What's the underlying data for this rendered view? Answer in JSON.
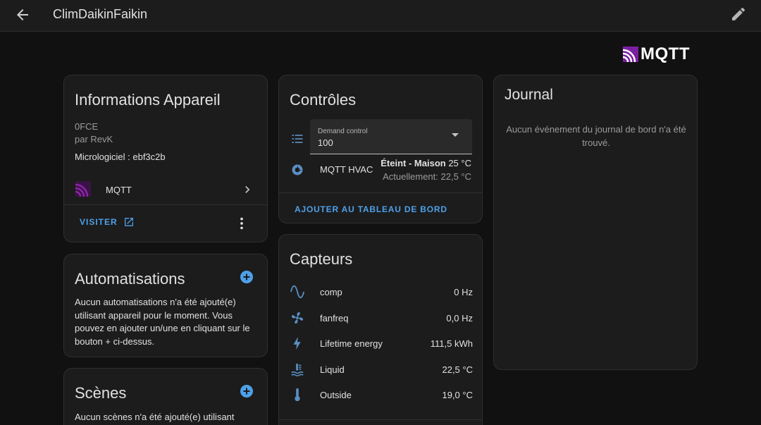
{
  "header": {
    "title": "ClimDaikinFaikin",
    "back_icon": "arrow-left-icon",
    "edit_icon": "pencil-icon"
  },
  "brand": {
    "logo_text": "MQTT",
    "accent_color": "#7b1fa2"
  },
  "device_info": {
    "title": "Informations Appareil",
    "model": "0FCE",
    "manufacturer": "par RevK",
    "firmware": "Micrologiciel : ebf3c2b",
    "integration": "MQTT",
    "visit_label": "VISITER"
  },
  "automations": {
    "title": "Automatisations",
    "empty_text": "Aucun automatisations n'a été ajouté(e) utilisant appareil pour le moment. Vous pouvez en ajouter un/une en cliquant sur le bouton + ci-dessus."
  },
  "scenes": {
    "title": "Scènes",
    "empty_text": "Aucun scènes n'a été ajouté(e) utilisant"
  },
  "controls": {
    "title": "Contrôles",
    "select": {
      "label": "Demand control",
      "value": "100"
    },
    "hvac": {
      "name": "MQTT HVAC",
      "state_bold": "Éteint - Maison",
      "state_temp": " 25 °C",
      "current": "Actuellement: 22,5 °C"
    },
    "add_to_dashboard": "AJOUTER AU TABLEAU DE BORD"
  },
  "sensors": {
    "title": "Capteurs",
    "items": [
      {
        "icon": "sine-wave-icon",
        "name": "comp",
        "value": "0 Hz"
      },
      {
        "icon": "fan-icon",
        "name": "fanfreq",
        "value": "0,0 Hz"
      },
      {
        "icon": "lightning-bolt-icon",
        "name": "Lifetime energy",
        "value": "111,5 kWh"
      },
      {
        "icon": "coolant-temperature-icon",
        "name": "Liquid",
        "value": "22,5 °C"
      },
      {
        "icon": "thermometer-icon",
        "name": "Outside",
        "value": "19,0 °C"
      }
    ]
  },
  "logbook": {
    "title": "Journal",
    "empty_text": "Aucun événement du journal de bord n'a été trouvé."
  },
  "colors": {
    "background": "#111111",
    "card": "#1c1c1c",
    "primary": "#4ea0e9",
    "icon": "#5a8fc5"
  }
}
